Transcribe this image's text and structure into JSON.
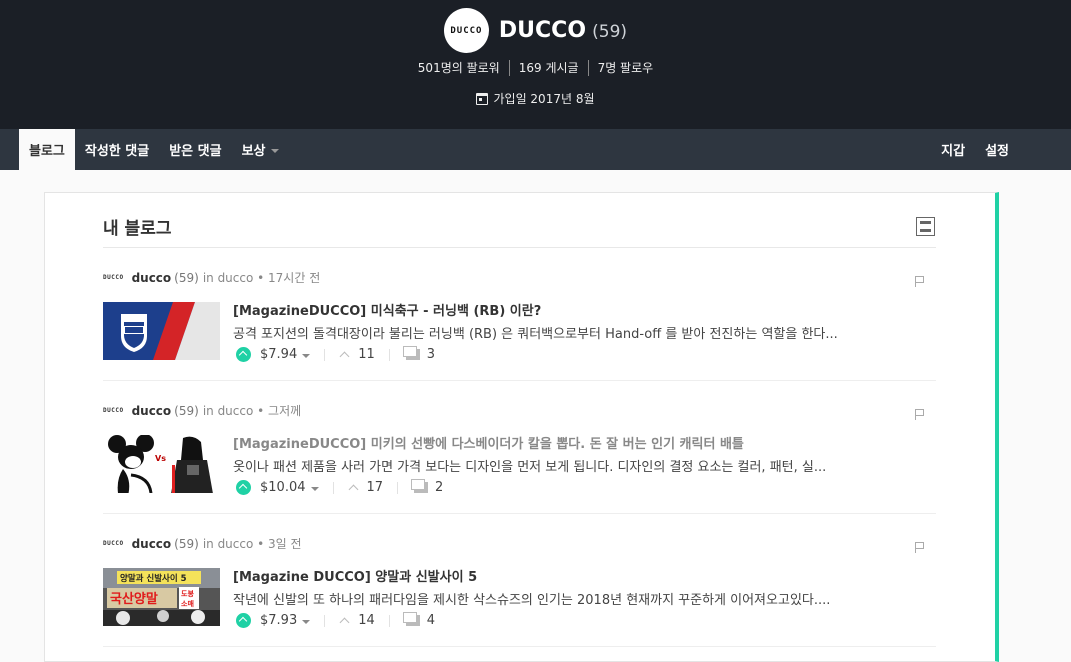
{
  "header": {
    "avatar_text": "DUCCO",
    "username": "DUCCO",
    "reputation": "(59)",
    "stats": [
      "501명의 팔로워",
      "169 게시글",
      "7명 팔로우"
    ],
    "joined": "가입일 2017년 8월"
  },
  "nav": {
    "left": [
      "블로그",
      "작성한 댓글",
      "받은 댓글",
      "보상"
    ],
    "right": [
      "지갑",
      "설정"
    ]
  },
  "blog": {
    "title": "내 블로그",
    "posts": [
      {
        "author": "ducco",
        "rep": "(59)",
        "meta": "in ducco • 17시간 전",
        "title": "[MagazineDUCCO] 미식축구 - 러닝백 (RB) 이란?",
        "body": "공격 포지션의 돌격대장이라 불리는 러닝백 (RB) 은 쿼터백으로부터 Hand-off 를 받아 전진하는 역할을 한다...",
        "payout": "$7.94",
        "votes": "11",
        "comments": "3"
      },
      {
        "author": "ducco",
        "rep": "(59)",
        "meta": "in ducco • 그저께",
        "title": "[MagazineDUCCO] 미키의 선빵에 다스베이더가 칼을 뽑다. 돈 잘 버는 인기 캐릭터 배틀",
        "body": "옷이나 패션 제품을 사러 가면 가격 보다는 디자인을 먼저 보게 됩니다. 디자인의 결정 요소는 컬러, 패턴, 실...",
        "payout": "$10.04",
        "votes": "17",
        "comments": "2"
      },
      {
        "author": "ducco",
        "rep": "(59)",
        "meta": "in ducco • 3일 전",
        "title": "[Magazine DUCCO] 양말과 신발사이 5",
        "body": "작년에 신발의 또 하나의 패러다임을 제시한 삭스슈즈의 인기는 2018년 현재까지 꾸준하게 이어져오고있다....",
        "payout": "$7.93",
        "votes": "14",
        "comments": "4"
      }
    ],
    "thumb3_text": [
      "양말과 신발사이 5",
      "국산양말",
      "도봉",
      "소매"
    ]
  },
  "colors": {
    "header_bg": "#1b1f26",
    "nav_bg": "#2e3640",
    "accent": "#1fd1a5"
  }
}
